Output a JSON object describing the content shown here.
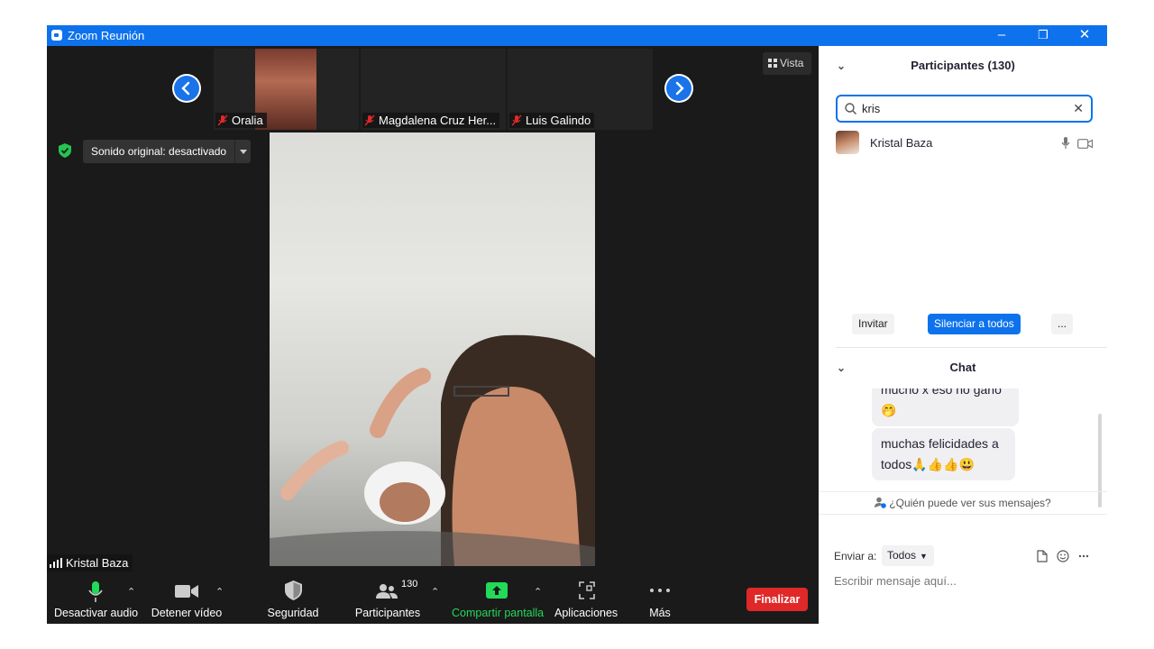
{
  "window": {
    "title": "Zoom Reunión",
    "minimize": "–",
    "restore": "❐",
    "close": "✕"
  },
  "gallery": {
    "thumbnails": [
      {
        "name": "Oralia"
      },
      {
        "name": "Magdalena Cruz Her..."
      },
      {
        "name": "Luis Galindo"
      }
    ],
    "prev_icon": "chevron-left-icon",
    "next_icon": "chevron-right-icon"
  },
  "view_button": {
    "label": "Vista"
  },
  "original_sound": {
    "label": "Sonido original: desactivado"
  },
  "active_speaker": {
    "name": "Kristal Baza"
  },
  "toolbar": {
    "audio_label": "Desactivar audio",
    "video_label": "Detener vídeo",
    "security_label": "Seguridad",
    "participants_label": "Participantes",
    "participants_count": "130",
    "share_label": "Compartir pantalla",
    "apps_label": "Aplicaciones",
    "more_label": "Más",
    "end_label": "Finalizar"
  },
  "participants_panel": {
    "title": "Participantes (130)",
    "search_value": "kris",
    "results": [
      {
        "name": "Kristal Baza"
      }
    ],
    "invite_label": "Invitar",
    "mute_all_label": "Silenciar a todos",
    "more_label": "..."
  },
  "chat": {
    "title": "Chat",
    "messages": [
      {
        "text": "mucho x eso no gano",
        "emoji": "🤭"
      },
      {
        "line1": "muchas felicidades a",
        "line2": "todos🙏👍👍😃"
      }
    ],
    "who_can_see": "¿Quién puede ver sus mensajes?",
    "send_to_label": "Enviar a:",
    "send_to_value": "Todos",
    "input_placeholder": "Escribir mensaje aquí..."
  },
  "colors": {
    "zoom_blue": "#0e72ed",
    "end_red": "#e02828",
    "share_green": "#23d959",
    "security_green": "#23c552",
    "mute_red": "#e02828"
  }
}
